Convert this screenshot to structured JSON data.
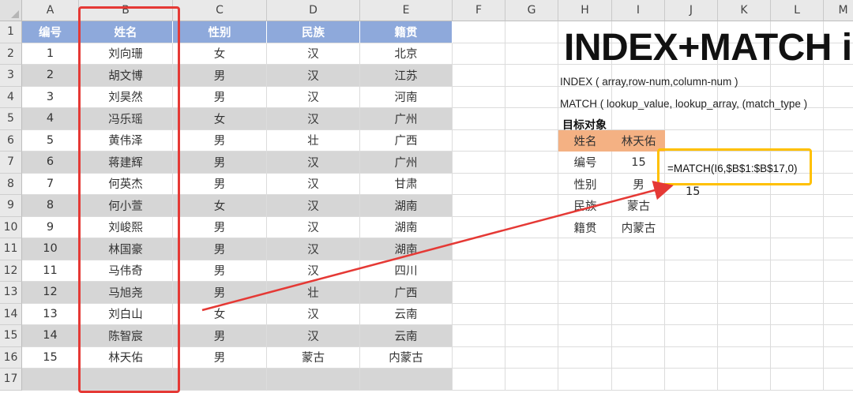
{
  "columns": [
    "A",
    "B",
    "C",
    "D",
    "E",
    "F",
    "G",
    "H",
    "I",
    "J",
    "K",
    "L",
    "M"
  ],
  "row_numbers": [
    "1",
    "2",
    "3",
    "4",
    "5",
    "6",
    "7",
    "8",
    "9",
    "10",
    "11",
    "12",
    "13",
    "14",
    "15",
    "16",
    "17"
  ],
  "table": {
    "headers": [
      "编号",
      "姓名",
      "性别",
      "民族",
      "籍贯"
    ],
    "rows": [
      [
        "1",
        "刘向珊",
        "女",
        "汉",
        "北京"
      ],
      [
        "2",
        "胡文博",
        "男",
        "汉",
        "江苏"
      ],
      [
        "3",
        "刘昊然",
        "男",
        "汉",
        "河南"
      ],
      [
        "4",
        "冯乐瑶",
        "女",
        "汉",
        "广州"
      ],
      [
        "5",
        "黄伟泽",
        "男",
        "壮",
        "广西"
      ],
      [
        "6",
        "蒋建辉",
        "男",
        "汉",
        "广州"
      ],
      [
        "7",
        "何英杰",
        "男",
        "汉",
        "甘肃"
      ],
      [
        "8",
        "何小萱",
        "女",
        "汉",
        "湖南"
      ],
      [
        "9",
        "刘峻熙",
        "男",
        "汉",
        "湖南"
      ],
      [
        "10",
        "林国豪",
        "男",
        "汉",
        "湖南"
      ],
      [
        "11",
        "马伟奇",
        "男",
        "汉",
        "四川"
      ],
      [
        "12",
        "马旭尧",
        "男",
        "壮",
        "广西"
      ],
      [
        "13",
        "刘白山",
        "女",
        "汉",
        "云南"
      ],
      [
        "14",
        "陈智宸",
        "男",
        "汉",
        "云南"
      ],
      [
        "15",
        "林天佑",
        "男",
        "蒙古",
        "内蒙古"
      ]
    ]
  },
  "title": "INDEX+MATCH i",
  "syntax": {
    "index": "INDEX ( array,row-num,column-num )",
    "match": "MATCH ( lookup_value, lookup_array, (match_type )"
  },
  "target": {
    "label": "目标对象",
    "rows": [
      {
        "key": "姓名",
        "value": "林天佑"
      },
      {
        "key": "编号",
        "value": "15"
      },
      {
        "key": "性别",
        "value": "男"
      },
      {
        "key": "民族",
        "value": "蒙古"
      },
      {
        "key": "籍贯",
        "value": "内蒙古"
      }
    ]
  },
  "formula": {
    "text": "=MATCH(I6,$B$1:$B$17,0)",
    "result": "15"
  },
  "colors": {
    "header_blue": "#8ea9db",
    "band_gray": "#d6d6d6",
    "highlight_orange": "#f4b183",
    "red_box": "#e53935",
    "yellow_box": "#ffc000"
  }
}
